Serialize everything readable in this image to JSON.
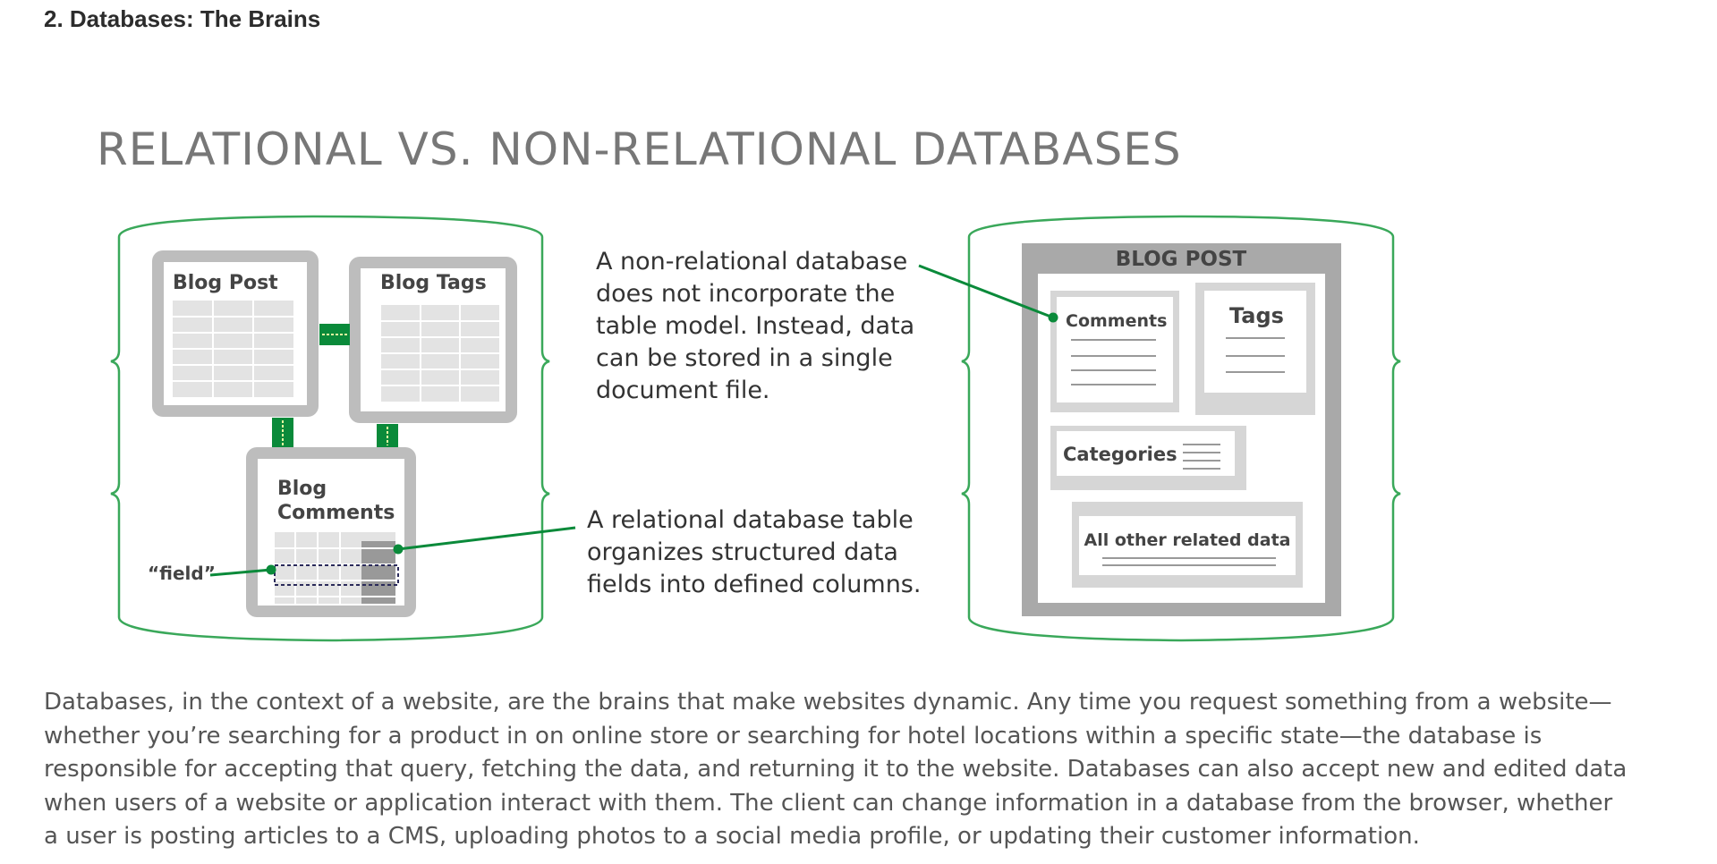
{
  "heading": "2. Databases: The Brains",
  "figure": {
    "title": "RELATIONAL VS. NON-RELATIONAL DATABASES",
    "relational": {
      "tables": {
        "blog_post": "Blog Post",
        "blog_tags": "Blog Tags",
        "blog_comments_line1": "Blog",
        "blog_comments_line2": "Comments"
      },
      "field_label": "“field”"
    },
    "callouts": {
      "non_relational": [
        "A non-relational database",
        "does not incorporate the",
        "table model. Instead, data",
        "can be stored in a single",
        "document file."
      ],
      "relational": [
        "A relational database table",
        "organizes structured data",
        "fields into defined columns."
      ]
    },
    "non_relational": {
      "document_title": "BLOG POST",
      "comments": "Comments",
      "tags": "Tags",
      "categories": "Categories",
      "all_other": "All other related data"
    },
    "colors": {
      "accent_green": "#0a8a3a",
      "outline_green": "#3aa85a",
      "table_gray": "#bdbdbd",
      "light_gray": "#e6e6e6"
    }
  },
  "body": {
    "lines": [
      "Databases, in the context of a website, are the brains that make websites dynamic. Any time you request something from a website—",
      "whether you’re searching for a product in on online store or searching for hotel locations within a specific state—the database is",
      "responsible for accepting that query, fetching the data, and returning it to the website. Databases can also accept new and edited data",
      "when users of a website or application interact with them. The client can change information in a database from the browser, whether",
      "a user is posting articles to a CMS, uploading photos to a social media profile, or updating their customer information."
    ]
  }
}
